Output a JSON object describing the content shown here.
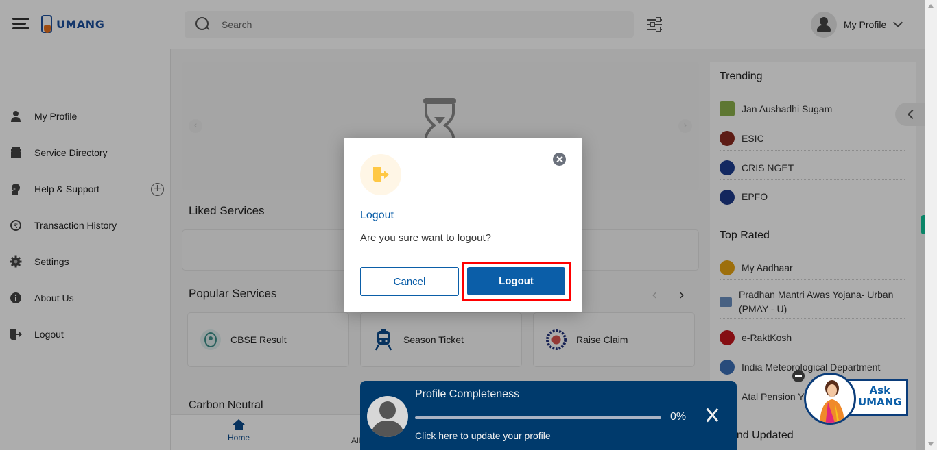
{
  "header": {
    "app_name": "UMANG",
    "search_placeholder": "Search",
    "profile_label": "My Profile"
  },
  "sidebar": {
    "items": [
      {
        "label": "My Profile",
        "icon": "user-icon"
      },
      {
        "label": "Service Directory",
        "icon": "archive-icon"
      },
      {
        "label": "Help & Support",
        "icon": "headset-icon",
        "expandable": true
      },
      {
        "label": "Transaction History",
        "icon": "rupee-history-icon"
      },
      {
        "label": "Settings",
        "icon": "gear-icon"
      },
      {
        "label": "About Us",
        "icon": "info-icon"
      },
      {
        "label": "Logout",
        "icon": "logout-icon"
      }
    ],
    "expand_symbol": "+"
  },
  "main": {
    "liked_services_title": "Liked Services",
    "popular_services_title": "Popular Services",
    "popular_services": [
      {
        "label": "CBSE Result",
        "icon": "cbse-logo-icon"
      },
      {
        "label": "Season Ticket",
        "icon": "train-icon"
      },
      {
        "label": "Raise Claim",
        "icon": "epfo-logo-icon"
      }
    ],
    "carbon_neutral_title": "Carbon Neutral",
    "prev_symbol": "‹",
    "next_symbol": "›"
  },
  "bottom_nav": {
    "home_label": "Home",
    "all_label_partial": "All"
  },
  "right_panel": {
    "trending_title": "Trending",
    "trending": [
      {
        "label": "Jan Aushadhi Sugam",
        "icon": "jan-aushadhi-logo-icon",
        "color": "#8bb04a"
      },
      {
        "label": "ESIC",
        "icon": "esic-logo-icon",
        "color": "#8a2a1f"
      },
      {
        "label": "CRIS NGET",
        "icon": "irctc-logo-icon",
        "color": "#1d3d8f"
      },
      {
        "label": "EPFO",
        "icon": "epfo-logo-icon",
        "color": "#1e3a8a"
      }
    ],
    "top_rated_title": "Top Rated",
    "top_rated": [
      {
        "label": "My Aadhaar",
        "icon": "aadhaar-logo-icon",
        "color": "#e8a413"
      },
      {
        "label": "Pradhan Mantri Awas Yojana- Urban (PMAY - U)",
        "icon": "pmay-logo-icon",
        "color": "#6a8fc0"
      },
      {
        "label": "e-RaktKosh",
        "icon": "eraktkosh-logo-icon",
        "color": "#c4161c"
      },
      {
        "label": "India Meteorological Department",
        "icon": "imd-logo-icon",
        "color": "#3b6fb6"
      },
      {
        "label": "Atal Pension Y",
        "icon": "apy-logo-icon",
        "color": "#999999"
      }
    ],
    "new_updated_title_partial": "w and Updated"
  },
  "dialog": {
    "title": "Logout",
    "message": "Are you sure want to logout?",
    "cancel_label": "Cancel",
    "confirm_label": "Logout",
    "icon_color": "#ffc845",
    "icon_bg": "#fff6e6"
  },
  "profile_toast": {
    "title": "Profile Completeness",
    "progress_percent": 0,
    "progress_label": "0%",
    "link_text": "Click here to update your profile"
  },
  "ask_umang": {
    "line1": "Ask",
    "line2": "UMANG"
  },
  "colors": {
    "brand_blue": "#0b5ea8",
    "toast_bg": "#003a6c",
    "highlight_red": "#ff0000",
    "accent_green": "#10c59a"
  }
}
